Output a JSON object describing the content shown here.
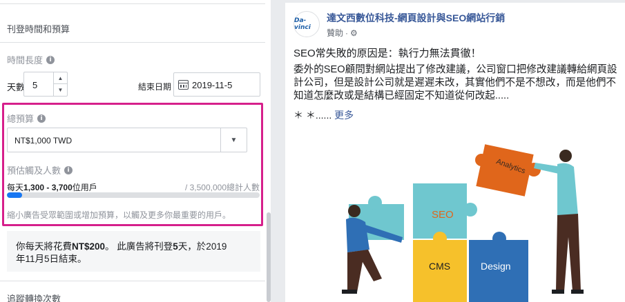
{
  "left_panel": {
    "section_title": "刊登時間和預算",
    "duration": {
      "label": "時間長度",
      "days_label": "天數",
      "days_value": "5",
      "end_date_label": "結束日期",
      "end_date_value": "2019-11-5"
    },
    "budget": {
      "label": "總預算",
      "value": "NT$1,000 TWD"
    },
    "reach": {
      "label": "預估觸及人數",
      "daily_prefix": "每天",
      "daily_range": "1,300 - 3,700",
      "daily_suffix": "位用戶",
      "total": "/ 3,500,000總計人數",
      "fraction": 0.06
    },
    "hint": "縮小廣告受眾範圍或增加預算，以觸及更多你最重要的用戶。",
    "summary": {
      "p1": "你每天將花費",
      "amount": "NT$200",
      "p2": "。 此廣告將刊登",
      "days": "5",
      "p3": "天，於2019",
      "line2": "年11月5日結束。"
    },
    "tracking_title": "追蹤轉換次數"
  },
  "ad_preview": {
    "avatar_text": "Da-vinci",
    "page_name": "達文西數位科技-網頁設計與SEO網站行銷",
    "sponsored": "贊助",
    "headline": "SEO常失敗的原因是：執行力無法貫徹！",
    "body": "委外的SEO顧問對網站提出了修改建議，公司窗口把修改建議轉給網頁設計公司，但是設計公司就是遲遲未改，其實他們不是不想改，而是他們不知道怎麼改或是結構已經固定不知道從何改起.....",
    "more_prefix": "＊ ＊......",
    "more_link": "更多",
    "puzzle": {
      "analytics": "Analytics",
      "seo": "SEO",
      "cms": "CMS",
      "design": "Design"
    }
  },
  "colors": {
    "highlight": "#d61f8b",
    "link": "#385898",
    "bar": "#1877f2",
    "puzzle_orange": "#e0661b",
    "puzzle_teal": "#6fc7cf",
    "puzzle_yellow": "#f6c12b",
    "puzzle_blue": "#2f6fb5"
  }
}
